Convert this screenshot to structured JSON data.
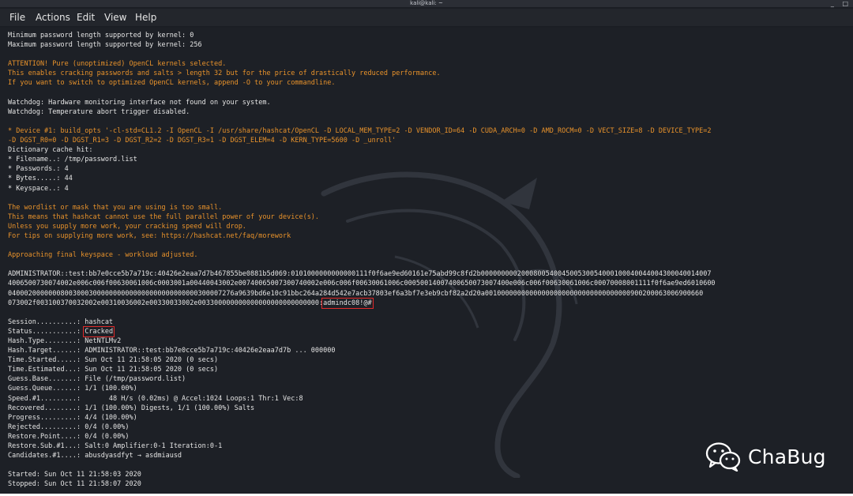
{
  "window": {
    "title": "kali@kali: ~",
    "controls": [
      "_",
      "□"
    ]
  },
  "menu": {
    "items": [
      "File",
      "Actions",
      "Edit",
      "View",
      "Help"
    ]
  },
  "terminal": {
    "lines": [
      [
        {
          "t": "Minimum password length supported by kernel: 0",
          "c": "w"
        }
      ],
      [
        {
          "t": "Maximum password length supported by kernel: 256",
          "c": "w"
        }
      ],
      [
        {
          "t": "",
          "c": "w"
        }
      ],
      [
        {
          "t": "ATTENTION! Pure (unoptimized) OpenCL kernels selected.",
          "c": "o"
        }
      ],
      [
        {
          "t": "This enables cracking passwords and salts > length 32 but for the price of drastically reduced performance.",
          "c": "o"
        }
      ],
      [
        {
          "t": "If you want to switch to optimized OpenCL kernels, append -O to your commandline.",
          "c": "o"
        }
      ],
      [
        {
          "t": "",
          "c": "w"
        }
      ],
      [
        {
          "t": "Watchdog: Hardware monitoring interface not found on your system.",
          "c": "w"
        }
      ],
      [
        {
          "t": "Watchdog: Temperature abort trigger disabled.",
          "c": "w"
        }
      ],
      [
        {
          "t": "",
          "c": "w"
        }
      ],
      [
        {
          "t": "* Device #1: build_opts '-cl-std=CL1.2 -I OpenCL -I /usr/share/hashcat/OpenCL -D LOCAL_MEM_TYPE=2 -D VENDOR_ID=64 -D CUDA_ARCH=0 -D AMD_ROCM=0 -D VECT_SIZE=8 -D DEVICE_TYPE=2",
          "c": "o"
        }
      ],
      [
        {
          "t": "-D DGST_R0=0 -D DGST_R1=3 -D DGST_R2=2 -D DGST_R3=1 -D DGST_ELEM=4 -D KERN_TYPE=5600 -D _unroll'",
          "c": "o"
        }
      ],
      [
        {
          "t": "Dictionary cache hit:",
          "c": "w"
        }
      ],
      [
        {
          "t": "* Filename..: /tmp/password.list",
          "c": "w"
        }
      ],
      [
        {
          "t": "* Passwords.: 4",
          "c": "w"
        }
      ],
      [
        {
          "t": "* Bytes.....: 44",
          "c": "w"
        }
      ],
      [
        {
          "t": "* Keyspace..: 4",
          "c": "w"
        }
      ],
      [
        {
          "t": "",
          "c": "w"
        }
      ],
      [
        {
          "t": "The wordlist or mask that you are using is too small.",
          "c": "o"
        }
      ],
      [
        {
          "t": "This means that hashcat cannot use the full parallel power of your device(s).",
          "c": "o"
        }
      ],
      [
        {
          "t": "Unless you supply more work, your cracking speed will drop.",
          "c": "o"
        }
      ],
      [
        {
          "t": "For tips on supplying more work, see: https://hashcat.net/faq/morework",
          "c": "o"
        }
      ],
      [
        {
          "t": "",
          "c": "w"
        }
      ],
      [
        {
          "t": "Approaching final keyspace - workload adjusted.",
          "c": "o"
        }
      ],
      [
        {
          "t": "",
          "c": "w"
        }
      ],
      [
        {
          "t": "ADMINISTRATOR::test:bb7e0cce5b7a719c:40426e2eaa7d7b467855be0881b5d069:0101000000000000111f0f6ae9ed60161e75abd99c8fd2b000000000200080054004500530054000100040044004300040014007",
          "c": "w"
        }
      ],
      [
        {
          "t": "4006500730074002e006c006f00630061006c0003001a00440043002e00740065007300740002e006c006f00630061006c00050014007400650073007400e006c006f00630061006c00070008001111f0f6ae9ed6010600",
          "c": "w"
        }
      ],
      [
        {
          "t": "04000200000008003000300000000000000000000000000300007276a9639bd6e10c91bbc264a284d542e7acb37803ef6a3bf7e3eb9cbf82a2d20a001000000000000000000000000000000000900200063006900660",
          "c": "w"
        }
      ],
      [
        {
          "t": "073002f003100370032002e00310036002e00330033002e003300000000000000000000000000:",
          "c": "w"
        },
        {
          "t": "admindc08!@#",
          "c": "w",
          "box": true
        }
      ],
      [
        {
          "t": "",
          "c": "w"
        }
      ],
      [
        {
          "t": "Session..........: hashcat",
          "c": "w"
        }
      ],
      [
        {
          "t": "Status...........: ",
          "c": "w"
        },
        {
          "t": "Cracked",
          "c": "w",
          "box": true
        }
      ],
      [
        {
          "t": "Hash.Type........: NetNTLMv2",
          "c": "w"
        }
      ],
      [
        {
          "t": "Hash.Target......: ADMINISTRATOR::test:bb7e0cce5b7a719c:40426e2eaa7d7b ... 000000",
          "c": "w"
        }
      ],
      [
        {
          "t": "Time.Started.....: Sun Oct 11 21:58:05 2020 (0 secs)",
          "c": "w"
        }
      ],
      [
        {
          "t": "Time.Estimated...: Sun Oct 11 21:58:05 2020 (0 secs)",
          "c": "w"
        }
      ],
      [
        {
          "t": "Guess.Base.......: File (/tmp/password.list)",
          "c": "w"
        }
      ],
      [
        {
          "t": "Guess.Queue......: 1/1 (100.00%)",
          "c": "w"
        }
      ],
      [
        {
          "t": "Speed.#1.........:       48 H/s (0.02ms) @ Accel:1024 Loops:1 Thr:1 Vec:8",
          "c": "w"
        }
      ],
      [
        {
          "t": "Recovered........: 1/1 (100.00%) Digests, 1/1 (100.00%) Salts",
          "c": "w"
        }
      ],
      [
        {
          "t": "Progress.........: 4/4 (100.00%)",
          "c": "w"
        }
      ],
      [
        {
          "t": "Rejected.........: 0/4 (0.00%)",
          "c": "w"
        }
      ],
      [
        {
          "t": "Restore.Point....: 0/4 (0.00%)",
          "c": "w"
        }
      ],
      [
        {
          "t": "Restore.Sub.#1...: Salt:0 Amplifier:0-1 Iteration:0-1",
          "c": "w"
        }
      ],
      [
        {
          "t": "Candidates.#1....: abusdyasdfyt → asdmiausd",
          "c": "w"
        }
      ],
      [
        {
          "t": "",
          "c": "w"
        }
      ],
      [
        {
          "t": "Started: Sun Oct 11 21:58:03 2020",
          "c": "w"
        }
      ],
      [
        {
          "t": "Stopped: Sun Oct 11 21:58:07 2020",
          "c": "w"
        }
      ]
    ]
  },
  "brand": {
    "name": "ChaBug",
    "icon": "wechat-icon"
  },
  "colors": {
    "terminal_bg": "#1d2026",
    "text_white": "#e4e4e4",
    "text_orange": "#e8922b",
    "highlight_box": "#e02a2a"
  }
}
